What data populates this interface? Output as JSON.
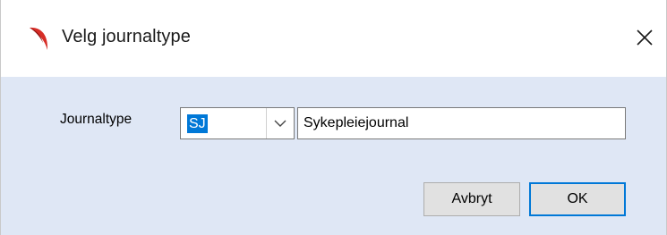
{
  "window": {
    "title": "Velg journaltype",
    "app_icon": "red-swoosh-logo-icon",
    "close_icon": "close-icon"
  },
  "form": {
    "journaltype_label": "Journaltype",
    "journaltype_code": "SJ",
    "journaltype_description": "Sykepleiejournal",
    "dropdown_icon": "chevron-down-icon"
  },
  "buttons": {
    "cancel_label": "Avbryt",
    "ok_label": "OK"
  },
  "colors": {
    "client_background": "#dfe7f5",
    "selection_highlight": "#0078d7",
    "default_button_border": "#0078d7",
    "app_icon_red": "#d62d27"
  }
}
